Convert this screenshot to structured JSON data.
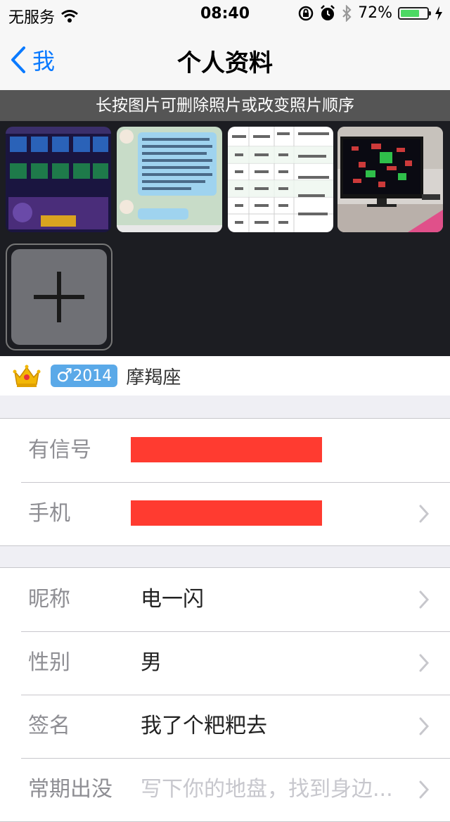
{
  "status_bar": {
    "carrier": "无服务",
    "time": "08:40",
    "battery_percent": "72%",
    "battery_level": 0.72
  },
  "nav": {
    "back_label": "我",
    "title": "个人资料"
  },
  "photos": {
    "hint": "长按图片可删除照片或改变照片顺序",
    "items": [
      {
        "name": "game-screenshot-thumbnail"
      },
      {
        "name": "chat-screenshot-thumbnail"
      },
      {
        "name": "table-screenshot-thumbnail"
      },
      {
        "name": "monitor-photo-thumbnail"
      }
    ]
  },
  "tags": {
    "gender_symbol": "♂",
    "year": "2014",
    "constellation": "摩羯座"
  },
  "account": {
    "rows": [
      {
        "label": "有信号",
        "value_redacted": true
      },
      {
        "label": "手机",
        "value_redacted": true
      }
    ]
  },
  "profile": {
    "rows": [
      {
        "label": "昵称",
        "value": "电一闪"
      },
      {
        "label": "性别",
        "value": "男"
      },
      {
        "label": "签名",
        "value": "我了个粑粑去"
      },
      {
        "label": "常期出没",
        "placeholder": "写下你的地盘，找到身边..."
      }
    ]
  },
  "colors": {
    "accent": "#0a7aff",
    "redaction": "#ff3b30",
    "gender_badge": "#5aa9e8",
    "photo_background": "#1c1d22"
  }
}
